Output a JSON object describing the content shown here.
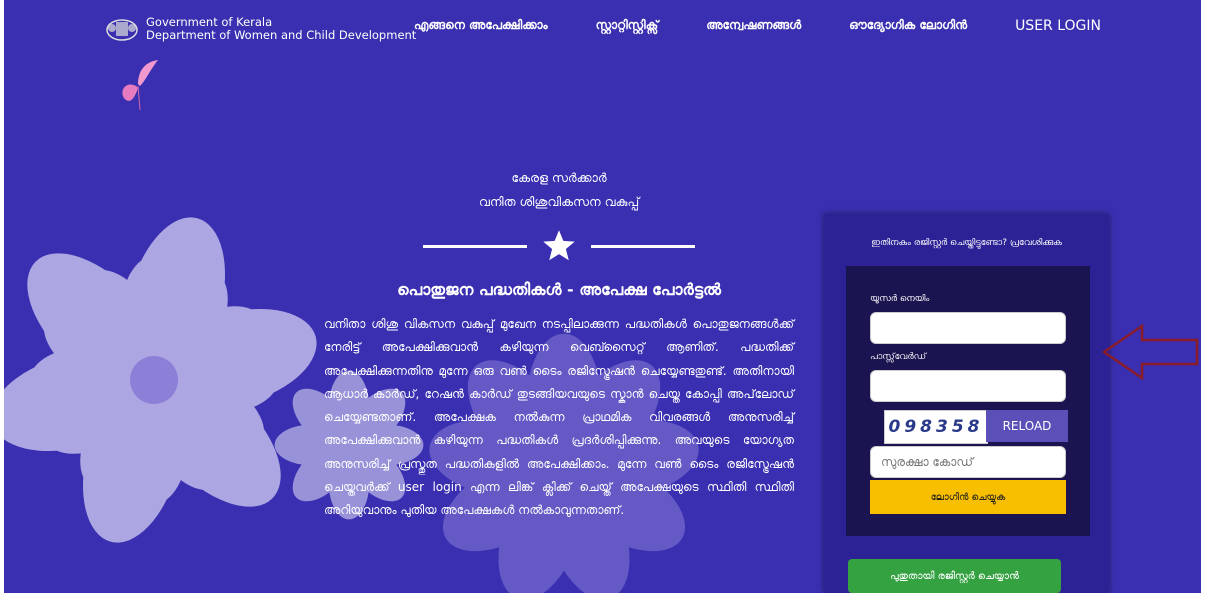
{
  "header": {
    "org_line1": "Government of Kerala",
    "org_line2": "Department of Women and Child Development",
    "nav": [
      "എങ്ങനെ അപേക്ഷിക്കാം",
      "സ്റ്റാറ്റിസ്റ്റിക്സ്",
      "അന്വേഷണങ്ങൾ",
      "ഔദ്യോഗിക ലോഗിൻ",
      "USER LOGIN"
    ]
  },
  "hero": {
    "sub1": "കേരള സർക്കാർ",
    "sub2": "വനിത ശിശുവികസന വകുപ്പ്",
    "heading": "പൊതുജന പദ്ധതികൾ - അപേക്ഷ പോർട്ടൽ",
    "body": "വനിതാ ശിശു വികസന വകുപ്പ് മുഖേന നടപ്പിലാക്കുന്ന പദ്ധതികൾ പൊതുജനങ്ങൾക്ക് നേരിട്ട് അപേക്ഷിക്കുവാൻ കഴിയുന്ന വെബ്സൈറ്റ് ആണിത്. പദ്ധതിക്ക് അപേക്ഷിക്കുന്നതിനു മുന്നേ ഒരു വൺ ടൈം രജിസ്ട്രേഷൻ ചെയ്യേണ്ടതുണ്ട്. അതിനായി ആധാർ കാർഡ്, റേഷൻ കാർഡ് തുടങ്ങിയവയുടെ സ്കാൻ ചെയ്ത കോപ്പി അപ്‌ലോഡ് ചെയ്യേണ്ടതാണ്. അപേക്ഷക നൽകുന്ന പ്രാഥമിക വിവരങ്ങൾ അനുസരിച്ച് അപേക്ഷിക്കുവാൻ കഴിയുന്ന പദ്ധതികൾ പ്രദർശിപ്പിക്കുന്നു. അവയുടെ യോഗ്യത അനുസരിച്ച് പ്രസ്തുത പദ്ധതികളിൽ അപേക്ഷിക്കാം. മുന്നേ വൺ ടൈം രജിസ്ട്രേഷൻ ചെയ്തവർക്ക് user login എന്ന ലിങ്ക് ക്ലിക്ക് ചെയ്ത് അപേക്ഷയുടെ സ്ഥിതി സ്ഥിതി അറിയുവാനും പുതിയ അപേക്ഷകൾ നൽകാവുന്നതാണ്."
  },
  "login": {
    "prompt": "ഇതിനകം രജിസ്റ്റർ ചെയ്തിട്ടുണ്ടോ? പ്രവേശിക്കുക",
    "username_label": "യൂസർ നെയിം",
    "username_value": "",
    "password_label": "പാസ്സ്‌വേർഡ്",
    "password_value": "",
    "captcha_text": "098358",
    "reload_label": "RELOAD",
    "security_placeholder": "സുരക്ഷാ കോഡ്",
    "login_button": "ലോഗിൻ ചെയ്യുക",
    "register_button": "പുതുതായി രജിസ്റ്റർ ചെയ്യാൻ"
  },
  "colors": {
    "background": "#3a2fb0",
    "panel": "#2c2296",
    "form": "#1a1450",
    "login_button": "#f8be00",
    "register_button": "#35a242",
    "arrow": "#8a1c2a"
  }
}
